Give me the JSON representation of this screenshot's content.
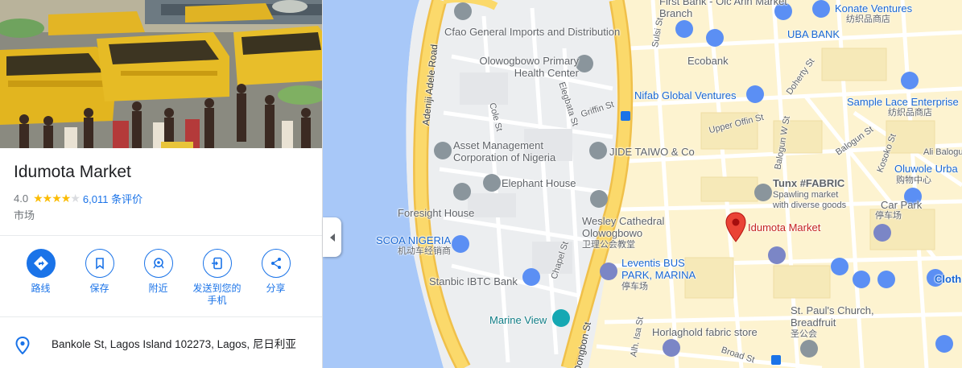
{
  "place": {
    "name": "Idumota Market",
    "rating": "4.0",
    "stars_filled": 4,
    "reviews": "6,011 条评价",
    "category": "市场",
    "address": "Bankole St, Lagos Island 102273, Lagos, 尼日利亚"
  },
  "actions": [
    {
      "label": "路线",
      "icon": "directions-icon"
    },
    {
      "label": "保存",
      "icon": "bookmark-icon"
    },
    {
      "label": "附近",
      "icon": "nearby-icon"
    },
    {
      "label": "发送到您的手机",
      "icon": "send-to-phone-icon"
    },
    {
      "label": "分享",
      "icon": "share-icon"
    }
  ],
  "map": {
    "selected": {
      "name": "Idumota Market"
    },
    "pois": {
      "cfao": "Cfao General Imports and Distribution",
      "olowogbowo": "Olowogbowo Primary Health Center",
      "first_bank": "First Bank - Olc Arin Market Branch",
      "uba": "UBA BANK",
      "konate": "Konate Ventures",
      "konate_sub": "纺织品商店",
      "ecobank": "Ecobank",
      "nifab": "Nifab Global Ventures",
      "sample_lace": "Sample Lace Enterprise",
      "sample_lace_sub": "纺织品商店",
      "asset": "Asset Management Corporation of Nigeria",
      "jide": "JIDE TAIWO & Co",
      "tunx": "Tunx #FABRIC",
      "tunx_sub": "Spawling market with diverse goods",
      "oluwole": "Oluwole Urba",
      "oluwole_sub": "购物中心",
      "ali": "Ali Balogun",
      "elephant": "Elephant House",
      "car_park": "Car Park",
      "car_park_sub": "停车场",
      "foresight": "Foresight House",
      "wesley": "Wesley Cathedral Olowogbowo",
      "wesley_sub": "卫理公会教堂",
      "scoa": "SCOA NIGERIA",
      "scoa_sub": "机动车经销商",
      "leventis": "Leventis BUS PARK, MARINA",
      "leventis_sub": "停车场",
      "stanbic": "Stanbic IBTC Bank",
      "marine_view": "Marine View",
      "st_pauls": "St. Paul's Church, Breadfruit",
      "st_pauls_sub": "圣公会",
      "horlaghold": "Horlaghold fabric store",
      "cloth": "Cloth"
    },
    "streets": {
      "adenji": "Adeniji Adele Road",
      "cole": "Cole St",
      "elegbata": "Elegbata St",
      "griffin": "Griffin St",
      "sulsi": "Sulsi St",
      "doherty": "Doherty St",
      "upper_offin": "Upper Offin St",
      "balogun_w": "Balogun W St",
      "balogun": "Balogun St",
      "kosoko": "Kosoko St",
      "chapel": "Chapel St",
      "isa": "Alh. Isa St",
      "broad": "Broad St",
      "obongbon": "Oongbon St"
    }
  }
}
